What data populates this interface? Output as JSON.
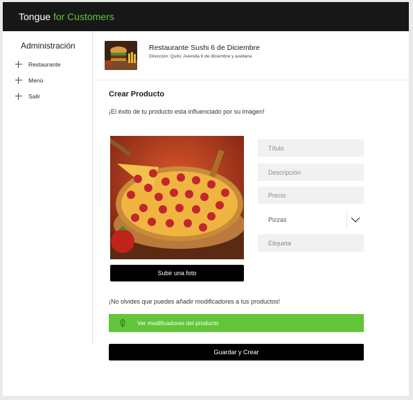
{
  "app": {
    "brand_primary": "Tongue",
    "brand_accent": "for Customers",
    "accent_color": "#63c53a"
  },
  "sidebar": {
    "title": "Administración",
    "items": [
      {
        "label": "Restaurante",
        "icon": "plus-icon"
      },
      {
        "label": "Menú",
        "icon": "plus-icon"
      },
      {
        "label": "Salir",
        "icon": "plus-icon"
      }
    ]
  },
  "restaurant": {
    "name": "Restaurante Sushi 6 de Diciembre",
    "address": "Dirección: Quito, Avenida 6 de diciembre y avellana"
  },
  "form": {
    "title": "Crear Producto",
    "subtitle": "¡El éxito de tu producto esta influenciado por su imagen!",
    "upload_label": "Subir una foto",
    "fields": {
      "title_placeholder": "Título",
      "description_placeholder": "Descripción",
      "price_placeholder": "Precio",
      "category_selected": "Pizzas",
      "tag_placeholder": "Etiqueta"
    },
    "reminder": "¡No olvides que puedes añadir modificadores a tus productos!",
    "modifiers_label": "Ver modificadores del producto",
    "submit_label": "Guardar y Crear"
  }
}
